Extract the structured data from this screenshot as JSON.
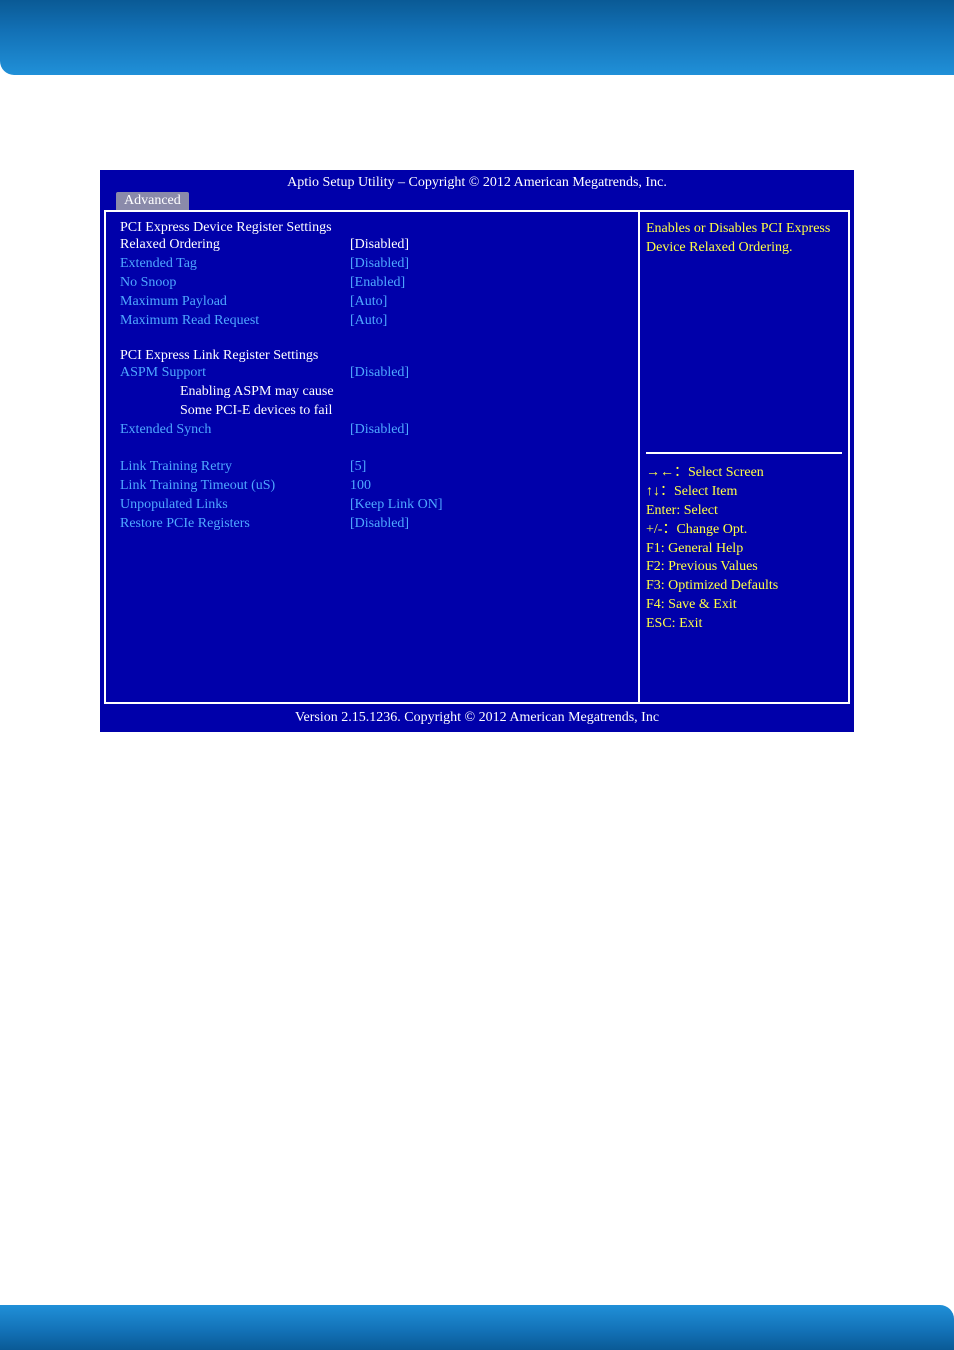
{
  "header": {
    "title": "Aptio Setup Utility  –  Copyright © 2012 American Megatrends, Inc.",
    "tab": "Advanced"
  },
  "left": {
    "section1_title": "PCI Express Device Register Settings",
    "items1": [
      {
        "label": "Relaxed Ordering",
        "value": "[Disabled]",
        "selected": true
      },
      {
        "label": "Extended Tag",
        "value": "[Disabled]"
      },
      {
        "label": "No Snoop",
        "value": "[Enabled]"
      },
      {
        "label": "Maximum Payload",
        "value": "[Auto]"
      },
      {
        "label": "Maximum Read Request",
        "value": "[Auto]"
      }
    ],
    "section2_title": "PCI Express Link Register Settings",
    "items2": [
      {
        "label": "ASPM Support",
        "value": "[Disabled]"
      }
    ],
    "note1": "Enabling ASPM may cause",
    "note2": "Some PCI-E devices to fail",
    "items3": [
      {
        "label": "Extended Synch",
        "value": "[Disabled]"
      }
    ],
    "items4": [
      {
        "label": "Link Training Retry",
        "value": "[5]"
      },
      {
        "label": "Link Training Timeout (uS)",
        "value": "100"
      },
      {
        "label": "Unpopulated Links",
        "value": "[Keep Link ON]"
      },
      {
        "label": "Restore PCIe Registers",
        "value": "[Disabled]"
      }
    ]
  },
  "help": {
    "text": "Enables or Disables PCI Express Device Relaxed Ordering.",
    "nav": [
      "→←：Select Screen",
      "↑↓：Select Item",
      "Enter: Select",
      "+/-：Change Opt.",
      "F1: General Help",
      "F2: Previous Values",
      "F3: Optimized Defaults",
      "F4: Save & Exit",
      "ESC: Exit"
    ]
  },
  "footer": "Version 2.15.1236. Copyright © 2012 American Megatrends, Inc"
}
